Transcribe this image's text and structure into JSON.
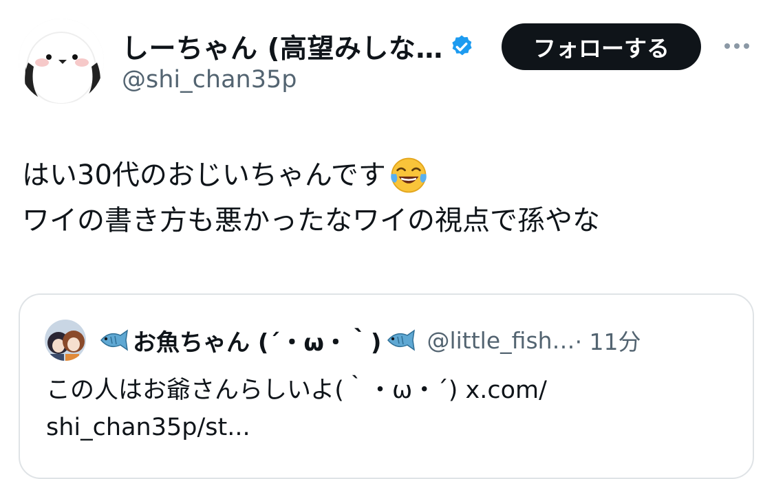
{
  "author": {
    "display_name": "しーちゃん (高望みしな…",
    "handle": "@shi_chan35p",
    "verified": true,
    "verified_color": "#1d9bf0"
  },
  "follow_button": {
    "label": "フォローする"
  },
  "more_icon": "more-horizontal-icon",
  "tweet": {
    "lines": [
      "はい30代のおじいちゃんです",
      "ワイの書き方も悪かったなワイの視点で孫やな"
    ],
    "emoji": "face-with-tears-of-joy-icon"
  },
  "quote": {
    "display_name": "お魚ちゃん (´・ω・｀)",
    "handle": "@little_fish…",
    "time": "· 11分",
    "text_lines": [
      "この人はお爺さんらしいよ(｀・ω・´) x.com/",
      "shi_chan35p/st..."
    ],
    "name_icon": "fish-icon"
  },
  "colors": {
    "text_primary": "#0f1419",
    "text_secondary": "#536471",
    "button_bg": "#0f1419",
    "card_border": "#dfe3e6"
  }
}
